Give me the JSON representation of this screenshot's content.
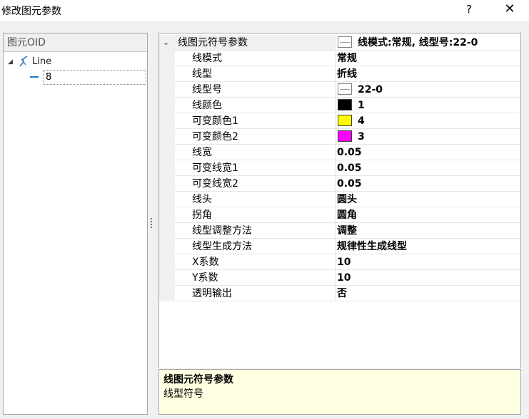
{
  "window": {
    "title": "修改图元参数",
    "help_glyph": "?",
    "close_glyph": "✕"
  },
  "tree": {
    "header": "图元OID",
    "root": {
      "label": "Line",
      "icon": "line-icon",
      "expanded": true
    },
    "child": {
      "label": "8",
      "selected": true
    }
  },
  "grid": {
    "category": {
      "name": "线图元符号参数",
      "value": "线模式:常规, 线型号:22-0"
    },
    "rows": [
      {
        "name": "线模式",
        "value": "常规"
      },
      {
        "name": "线型",
        "value": "折线"
      },
      {
        "name": "线型号",
        "value": "22-0",
        "swatch": "line"
      },
      {
        "name": "线颜色",
        "value": "1",
        "swatch": "#000000"
      },
      {
        "name": "可变颜色1",
        "value": "4",
        "swatch": "#ffff00"
      },
      {
        "name": "可变颜色2",
        "value": "3",
        "swatch": "#ff00ff"
      },
      {
        "name": "线宽",
        "value": "0.05"
      },
      {
        "name": "可变线宽1",
        "value": "0.05"
      },
      {
        "name": "可变线宽2",
        "value": "0.05"
      },
      {
        "name": "线头",
        "value": "圆头"
      },
      {
        "name": "拐角",
        "value": "圆角"
      },
      {
        "name": "线型调整方法",
        "value": "调整"
      },
      {
        "name": "线型生成方法",
        "value": "规律性生成线型"
      },
      {
        "name": "X系数",
        "value": "10"
      },
      {
        "name": "Y系数",
        "value": "10"
      },
      {
        "name": "透明输出",
        "value": "否"
      }
    ]
  },
  "description": {
    "title": "线图元符号参数",
    "text": "线型符号"
  },
  "colors": {
    "desc_background": "#ffffe1",
    "tree_accent": "#1e73c8"
  }
}
